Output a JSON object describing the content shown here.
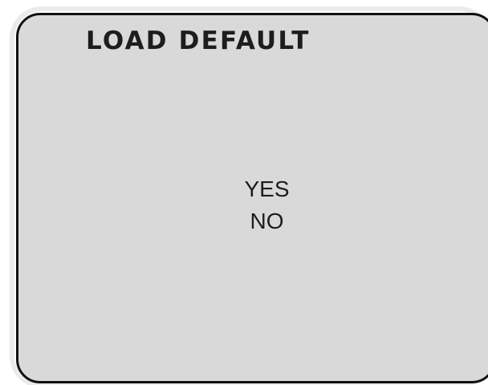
{
  "menu": {
    "title": "LOAD DEFAULT",
    "options": [
      {
        "label": "YES"
      },
      {
        "label": "NO"
      }
    ]
  },
  "colors": {
    "screen_background": "#d9d9d9",
    "border": "#111111",
    "text": "#1d1d1d"
  }
}
